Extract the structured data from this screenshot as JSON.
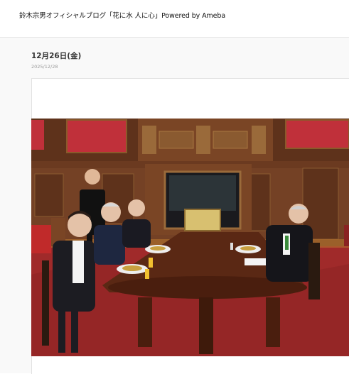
{
  "header": {
    "blog_title": "鈴木宗男オフィシャルブログ「花に水 人に心」Powered by Ameba"
  },
  "entry": {
    "title": "12月26日(金)",
    "date": "2025/12/28",
    "photo": {
      "icon": "dinner-meeting-photo"
    }
  },
  "colors": {
    "wall_red": "#c0303a",
    "wood": "#6b3a20",
    "table": "#5a2814",
    "carpet": "#a02a2a"
  }
}
